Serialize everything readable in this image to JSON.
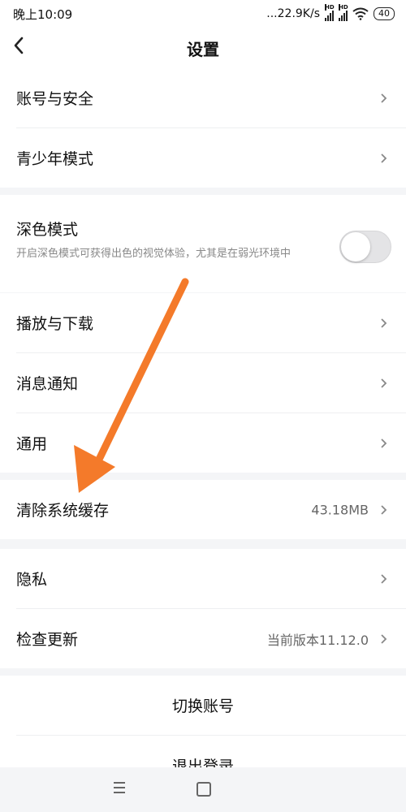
{
  "status_bar": {
    "time": "晚上10:09",
    "network_speed": "...22.9K/s",
    "signal1_label": "HD",
    "signal2_label": "HD",
    "battery": "40"
  },
  "header": {
    "title": "设置",
    "back_icon": "chevron-left-icon"
  },
  "groups": [
    {
      "items": [
        {
          "label": "账号与安全"
        },
        {
          "label": "青少年模式"
        }
      ]
    },
    {
      "dark_mode": {
        "label": "深色模式",
        "description": "开启深色模式可获得出色的视觉体验，尤其是在弱光环境中",
        "enabled": false
      }
    },
    {
      "items": [
        {
          "label": "播放与下载"
        },
        {
          "label": "消息通知"
        },
        {
          "label": "通用"
        }
      ]
    },
    {
      "items": [
        {
          "label": "清除系统缓存",
          "value": "43.18MB"
        }
      ]
    },
    {
      "items": [
        {
          "label": "隐私"
        },
        {
          "label": "检查更新",
          "value": "当前版本11.12.0"
        }
      ]
    },
    {
      "actions": [
        {
          "label": "切换账号"
        },
        {
          "label": "退出登录"
        }
      ]
    }
  ],
  "annotation": {
    "arrow_color": "#f47a2a"
  },
  "nav_bar": {
    "menu_icon": "menu-icon",
    "home_icon": "home-square-icon"
  }
}
